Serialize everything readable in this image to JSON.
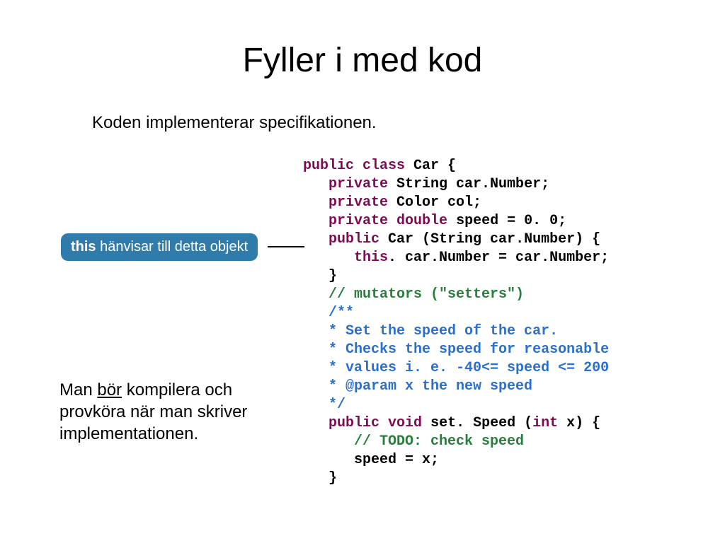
{
  "title": "Fyller i med kod",
  "subtitle": "Koden implementerar specifikationen.",
  "callout": {
    "keyword": "this",
    "text": " hänvisar till detta objekt"
  },
  "note": {
    "p1": "Man ",
    "underline": "bör",
    "p2": " kompilera och provköra när man skriver implementationen."
  },
  "code": {
    "l1": {
      "a": "public",
      "b": " ",
      "c": "class",
      "d": " Car {"
    },
    "l2": {
      "a": "   ",
      "b": "private",
      "c": " String car.Number;"
    },
    "l3": {
      "a": "   ",
      "b": "private",
      "c": " Color col;"
    },
    "l4": {
      "a": "   ",
      "b": "private",
      "c": " ",
      "d": "double",
      "e": " speed = 0. 0;"
    },
    "l5": {
      "a": "   ",
      "b": "public",
      "c": " Car (String car.Number) {"
    },
    "l6": {
      "a": "      ",
      "b": "this",
      "c": ". car.Number = car.Number;"
    },
    "l7": "   }",
    "l8": {
      "a": "   ",
      "b": "// mutators (\"setters\")"
    },
    "l9": {
      "a": "   ",
      "b": "/**"
    },
    "l10": {
      "a": "   ",
      "b": "* Set the speed of the car."
    },
    "l11": {
      "a": "   ",
      "b": "* Checks the speed for reasonable"
    },
    "l12": {
      "a": "   ",
      "b": "* values i. e. -40<= speed <= 200"
    },
    "l13": {
      "a": "   ",
      "b": "* @param x the new speed"
    },
    "l14": {
      "a": "   ",
      "b": "*/"
    },
    "l15": {
      "a": "   ",
      "b": "public",
      "c": " ",
      "d": "void",
      "e": " set. Speed (",
      "f": "int",
      "g": " x) {"
    },
    "l16": {
      "a": "      ",
      "b": "// TODO: check speed"
    },
    "l17": "      speed = x;",
    "l18": "   }"
  }
}
